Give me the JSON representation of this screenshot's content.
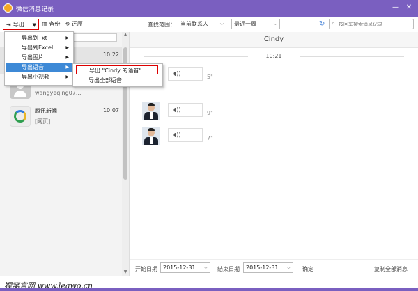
{
  "window": {
    "title": "微信消息记录",
    "controls": [
      "—",
      "✕"
    ],
    "accent": "#7a5fc0"
  },
  "toolbar": {
    "export_label": "导出",
    "backup_label": "备份",
    "restore_label": "还原",
    "scope_label": "查找范围：",
    "scope_value": "当前联系人",
    "period_value": "最近一周",
    "search_placeholder": "按回车搜索消息记录"
  },
  "export_menu": {
    "items": [
      {
        "label": "导出到Txt"
      },
      {
        "label": "导出到Excel"
      },
      {
        "label": "导出图片"
      },
      {
        "label": "导出语音"
      },
      {
        "label": "导出小视频"
      }
    ],
    "active_index": 3,
    "submenu": [
      {
        "label": "导出 \"Cindy 的语音\""
      },
      {
        "label": "导出全部语音"
      }
    ]
  },
  "contacts": [
    {
      "name": "",
      "sub": "",
      "time": "10:22"
    },
    {
      "name": "",
      "sub": "wangyeqing07...",
      "time": ""
    },
    {
      "name": "腾讯新闻",
      "sub": "[网页]",
      "time": "10:07"
    }
  ],
  "chat": {
    "contact_name": "Cindy",
    "time_separator": "10:21",
    "messages": [
      {
        "duration": "5\""
      },
      {
        "duration": "9\""
      },
      {
        "duration": "7\""
      }
    ]
  },
  "footer": {
    "start_label": "开始日期",
    "start_date": "2015-12-31",
    "end_label": "结束日期",
    "end_date": "2015-12-31",
    "confirm_label": "确定",
    "copy_all_label": "复制全部消息"
  },
  "watermark": "狸窝官网 www.leawo.cn"
}
